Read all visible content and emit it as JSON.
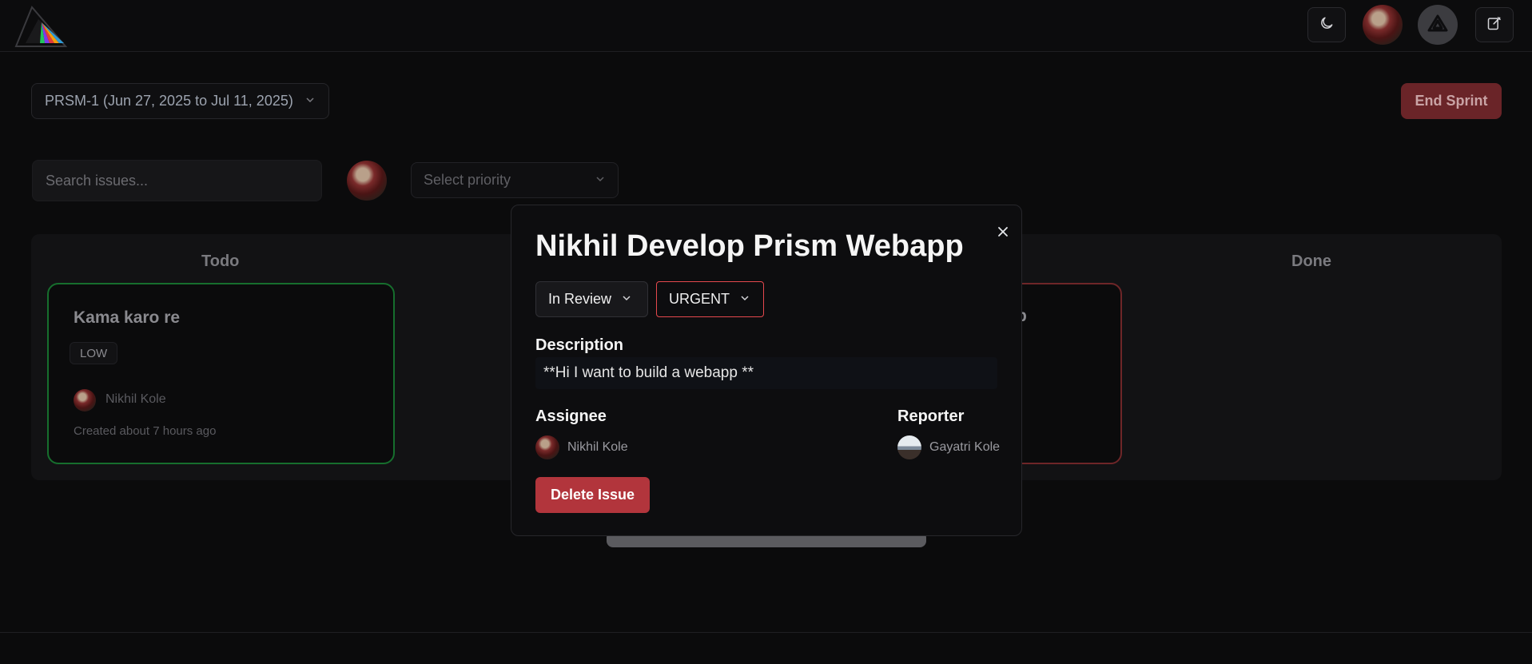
{
  "header": {
    "theme_toggle_icon": "moon-icon",
    "new_issue_icon": "edit-icon"
  },
  "sprint": {
    "selected": "PRSM-1 (Jun 27, 2025 to Jul 11, 2025)",
    "end_label": "End Sprint"
  },
  "filters": {
    "search_placeholder": "Search issues...",
    "priority_placeholder": "Select priority"
  },
  "board": {
    "columns": [
      {
        "title": "Todo"
      },
      {
        "title": "Done"
      }
    ],
    "todo_card": {
      "title": "Kama karo re",
      "priority": "LOW",
      "assignee": "Nikhil Kole",
      "created": "Created about 7 hours ago"
    },
    "review_card_fragment": "p"
  },
  "modal": {
    "title": "Nikhil Develop Prism Webapp",
    "status": "In Review",
    "priority": "URGENT",
    "description_label": "Description",
    "description": "**Hi I want to build a webapp **",
    "assignee_label": "Assignee",
    "assignee_name": "Nikhil Kole",
    "reporter_label": "Reporter",
    "reporter_name": "Gayatri Kole",
    "delete_label": "Delete Issue"
  },
  "colors": {
    "background": "#0b0b0c",
    "danger": "#b2353c",
    "urgent_border": "#e5484d",
    "todo_border": "#166e2d",
    "review_border": "#6e2628"
  }
}
